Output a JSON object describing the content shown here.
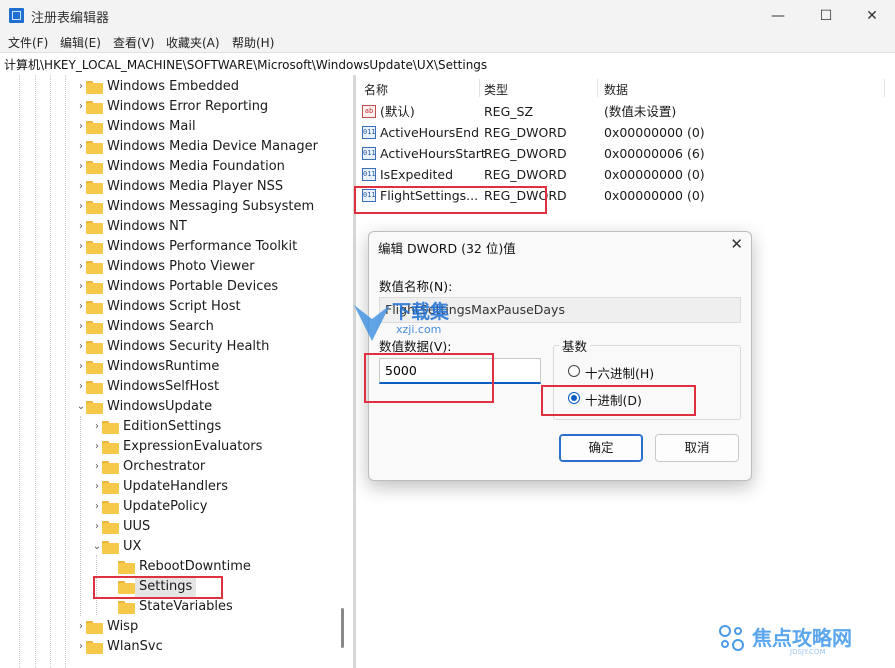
{
  "window": {
    "title": "注册表编辑器",
    "minimize_glyph": "—",
    "maximize_glyph": "☐",
    "close_glyph": "✕"
  },
  "menu": [
    "文件(F)",
    "编辑(E)",
    "查看(V)",
    "收藏夹(A)",
    "帮助(H)"
  ],
  "address": "计算机\\HKEY_LOCAL_MACHINE\\SOFTWARE\\Microsoft\\WindowsUpdate\\UX\\Settings",
  "tree": [
    {
      "label": "Windows Embedded",
      "depth": 0,
      "chevron": "›"
    },
    {
      "label": "Windows Error Reporting",
      "depth": 0,
      "chevron": "›"
    },
    {
      "label": "Windows Mail",
      "depth": 0,
      "chevron": "›"
    },
    {
      "label": "Windows Media Device Manager",
      "depth": 0,
      "chevron": "›"
    },
    {
      "label": "Windows Media Foundation",
      "depth": 0,
      "chevron": "›"
    },
    {
      "label": "Windows Media Player NSS",
      "depth": 0,
      "chevron": "›"
    },
    {
      "label": "Windows Messaging Subsystem",
      "depth": 0,
      "chevron": "›"
    },
    {
      "label": "Windows NT",
      "depth": 0,
      "chevron": "›"
    },
    {
      "label": "Windows Performance Toolkit",
      "depth": 0,
      "chevron": "›"
    },
    {
      "label": "Windows Photo Viewer",
      "depth": 0,
      "chevron": "›"
    },
    {
      "label": "Windows Portable Devices",
      "depth": 0,
      "chevron": "›"
    },
    {
      "label": "Windows Script Host",
      "depth": 0,
      "chevron": "›"
    },
    {
      "label": "Windows Search",
      "depth": 0,
      "chevron": "›"
    },
    {
      "label": "Windows Security Health",
      "depth": 0,
      "chevron": "›"
    },
    {
      "label": "WindowsRuntime",
      "depth": 0,
      "chevron": "›"
    },
    {
      "label": "WindowsSelfHost",
      "depth": 0,
      "chevron": "›"
    },
    {
      "label": "WindowsUpdate",
      "depth": 0,
      "chevron": "⌄"
    },
    {
      "label": "EditionSettings",
      "depth": 1,
      "chevron": "›"
    },
    {
      "label": "ExpressionEvaluators",
      "depth": 1,
      "chevron": "›"
    },
    {
      "label": "Orchestrator",
      "depth": 1,
      "chevron": "›"
    },
    {
      "label": "UpdateHandlers",
      "depth": 1,
      "chevron": "›"
    },
    {
      "label": "UpdatePolicy",
      "depth": 1,
      "chevron": "›"
    },
    {
      "label": "UUS",
      "depth": 1,
      "chevron": "›"
    },
    {
      "label": "UX",
      "depth": 1,
      "chevron": "⌄"
    },
    {
      "label": "RebootDowntime",
      "depth": 2,
      "chevron": ""
    },
    {
      "label": "Settings",
      "depth": 2,
      "chevron": "",
      "selected": true
    },
    {
      "label": "StateVariables",
      "depth": 2,
      "chevron": ""
    },
    {
      "label": "Wisp",
      "depth": 0,
      "chevron": "›"
    },
    {
      "label": "WlanSvc",
      "depth": 0,
      "chevron": "›"
    }
  ],
  "list": {
    "headers": {
      "name": "名称",
      "type": "类型",
      "data": "数据"
    },
    "rows": [
      {
        "icon": "ab",
        "kind": "str",
        "name": "(默认)",
        "type": "REG_SZ",
        "data": "(数值未设置)"
      },
      {
        "icon": "011",
        "kind": "dword",
        "name": "ActiveHoursEnd",
        "type": "REG_DWORD",
        "data": "0x00000000 (0)"
      },
      {
        "icon": "011",
        "kind": "dword",
        "name": "ActiveHoursStart",
        "type": "REG_DWORD",
        "data": "0x00000006 (6)"
      },
      {
        "icon": "011",
        "kind": "dword",
        "name": "IsExpedited",
        "type": "REG_DWORD",
        "data": "0x00000000 (0)"
      },
      {
        "icon": "011",
        "kind": "dword",
        "name": "FlightSettings...",
        "type": "REG_DWORD",
        "data": "0x00000000 (0)"
      }
    ]
  },
  "dialog": {
    "title": "编辑 DWORD (32 位)值",
    "close_glyph": "✕",
    "name_label": "数值名称(N):",
    "name_value": "FlightSettingsMaxPauseDays",
    "data_label": "数值数据(V):",
    "data_value": "5000",
    "base_label": "基数",
    "radio_hex": "十六进制(H)",
    "radio_dec": "十进制(D)",
    "ok": "确定",
    "cancel": "取消"
  },
  "watermark": {
    "line1": "下载集",
    "line2": "xzji.com"
  },
  "brand": {
    "text": "焦点攻略网",
    "sub": "JDSJY.COM"
  },
  "colors": {
    "highlight": "#e03040",
    "accent": "#0a5cc2",
    "folder": "#f7c94a"
  }
}
